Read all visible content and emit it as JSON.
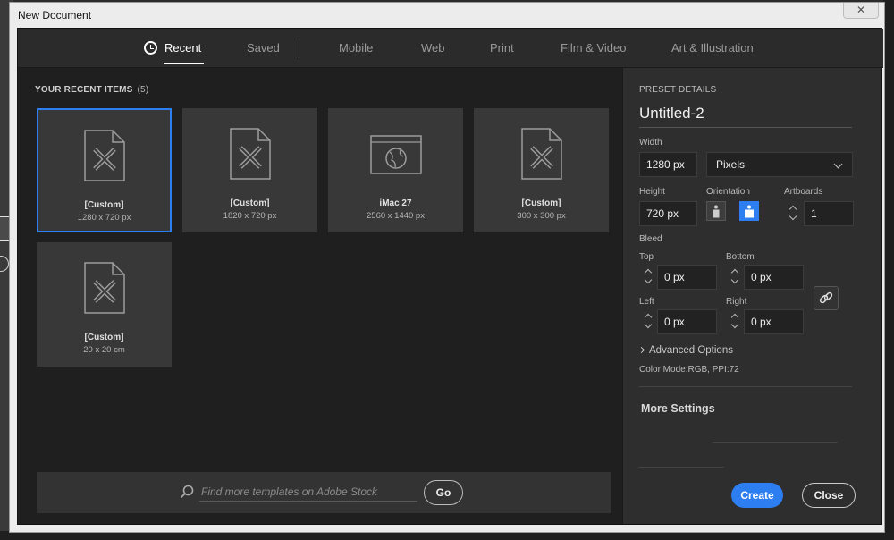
{
  "window": {
    "title": "New Document",
    "close_glyph": "✕"
  },
  "tabs": [
    {
      "label": "Recent",
      "active": true
    },
    {
      "label": "Saved"
    },
    {
      "label": "Mobile"
    },
    {
      "label": "Web"
    },
    {
      "label": "Print"
    },
    {
      "label": "Film & Video"
    },
    {
      "label": "Art & Illustration"
    }
  ],
  "recent": {
    "heading": "YOUR RECENT ITEMS",
    "count": "(5)",
    "items": [
      {
        "name": "[Custom]",
        "size": "1280 x 720 px",
        "icon": "document-pencil-icon",
        "selected": true
      },
      {
        "name": "[Custom]",
        "size": "1820 x 720 px",
        "icon": "document-pencil-icon"
      },
      {
        "name": "iMac 27",
        "size": "2560 x 1440 px",
        "icon": "web-browser-globe-icon"
      },
      {
        "name": "[Custom]",
        "size": "300 x 300 px",
        "icon": "document-pencil-icon"
      },
      {
        "name": "[Custom]",
        "size": "20 x 20 cm",
        "icon": "document-pencil-icon"
      }
    ]
  },
  "stock": {
    "placeholder": "Find more templates on Adobe Stock",
    "go_label": "Go"
  },
  "preset": {
    "heading": "PRESET DETAILS",
    "name": "Untitled-2",
    "width_label": "Width",
    "width": "1280 px",
    "units": "Pixels",
    "height_label": "Height",
    "height": "720 px",
    "orientation_label": "Orientation",
    "artboards_label": "Artboards",
    "artboards": "1",
    "bleed_label": "Bleed",
    "top_label": "Top",
    "top": "0 px",
    "bottom_label": "Bottom",
    "bottom": "0 px",
    "left_label": "Left",
    "left": "0 px",
    "right_label": "Right",
    "right": "0 px",
    "advanced": "Advanced Options",
    "color_mode": "Color Mode:RGB, PPI:72",
    "more_settings": "More Settings",
    "create": "Create",
    "close": "Close"
  },
  "colors": {
    "accent": "#2d7ef1",
    "panel": "#2e2e2e",
    "canvas": "#1f1f1f",
    "card": "#383838"
  }
}
